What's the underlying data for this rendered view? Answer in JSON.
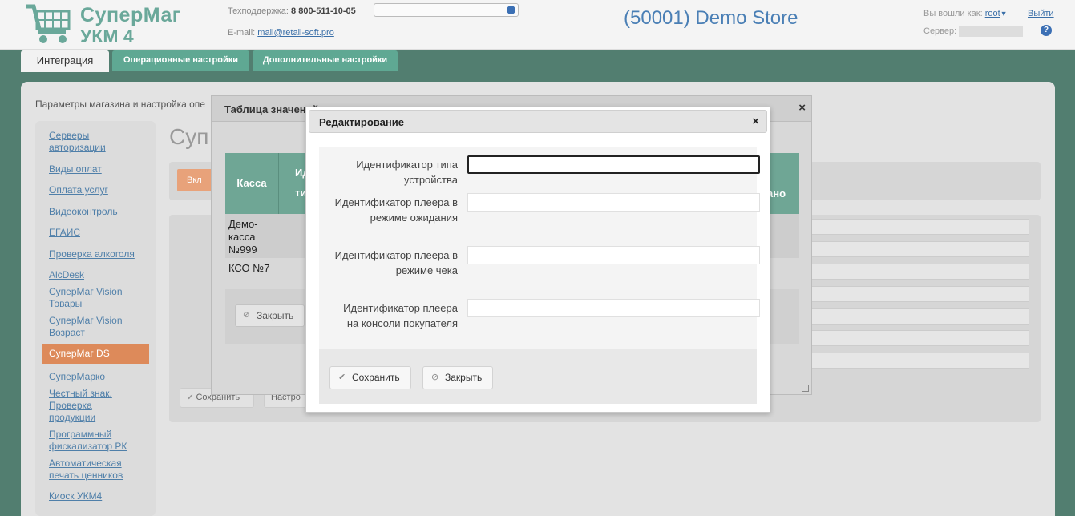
{
  "header": {
    "logo_line1": "СуперМаг",
    "logo_line2": "УКМ 4",
    "support_label": "Техподдержка:",
    "support_phone": "8 800-511-10-05",
    "email_label": "E-mail:",
    "email": "mail@retail-soft.pro",
    "store": "(50001) Demo Store",
    "user_label": "Вы вошли как:",
    "user": "root",
    "user_arrow": "▼",
    "server_label": "Сервер:",
    "logout": "Выйти",
    "help": "?"
  },
  "tabs": [
    {
      "label": "Интеграция",
      "active": true
    },
    {
      "label": "Операционные настройки",
      "active": false
    },
    {
      "label": "Дополнительные настройки",
      "active": false
    }
  ],
  "breadcrumb": "Параметры магазина и настройка опе",
  "sidebar": {
    "items": [
      {
        "label": "Серверы авторизации"
      },
      {
        "label": "Виды оплат"
      },
      {
        "label": "Оплата услуг"
      },
      {
        "label": "Видеоконтроль"
      },
      {
        "label": "ЕГАИС"
      },
      {
        "label": "Проверка алкоголя"
      },
      {
        "label": "AlcDesk"
      },
      {
        "label": "СуперМаг Vision Товары"
      },
      {
        "label": "СуперМаг Vision Возраст"
      },
      {
        "label": "СуперМаг DS",
        "active": true
      },
      {
        "label": "СуперМарко"
      },
      {
        "label": "Честный знак. Проверка продукции"
      },
      {
        "label": "Программный фискализатор РК"
      },
      {
        "label": "Автоматическая печать ценников"
      },
      {
        "label": "Киоск УКМ4"
      }
    ]
  },
  "background": {
    "title": "Суп",
    "orange_button": "Вкл",
    "save_button": "Сохранить",
    "settings_button": "Настро"
  },
  "table_dialog": {
    "title": "Таблица значений",
    "close": "×",
    "col_kassa": "Касса",
    "col_2a": "Ид",
    "col_2b": "ти",
    "col_last": "ано",
    "rows": [
      "Демо-касса №999",
      "КСО №7"
    ],
    "close_button": "Закрыть"
  },
  "edit_dialog": {
    "title": "Редактирование",
    "close": "×",
    "fields": [
      {
        "label": "Идентификатор типа устройства",
        "value": "",
        "placeholder": ""
      },
      {
        "label": "Идентификатор плеера в режиме ожидания",
        "value": "",
        "placeholder": ""
      },
      {
        "label": "Идентификатор плеера в режиме чека",
        "value": "",
        "placeholder": ""
      },
      {
        "label": "Идентификатор плеера на консоли покупателя",
        "value": "",
        "placeholder": ""
      }
    ],
    "save_button": "Сохранить",
    "close_button": "Закрыть",
    "save_icon": "check-icon",
    "close_icon": "forbidden-icon"
  },
  "colors": {
    "accent": "#4a7fb5",
    "teal": "#527e70",
    "tab": "#5fa893",
    "active_nav": "#dd8a5a"
  }
}
